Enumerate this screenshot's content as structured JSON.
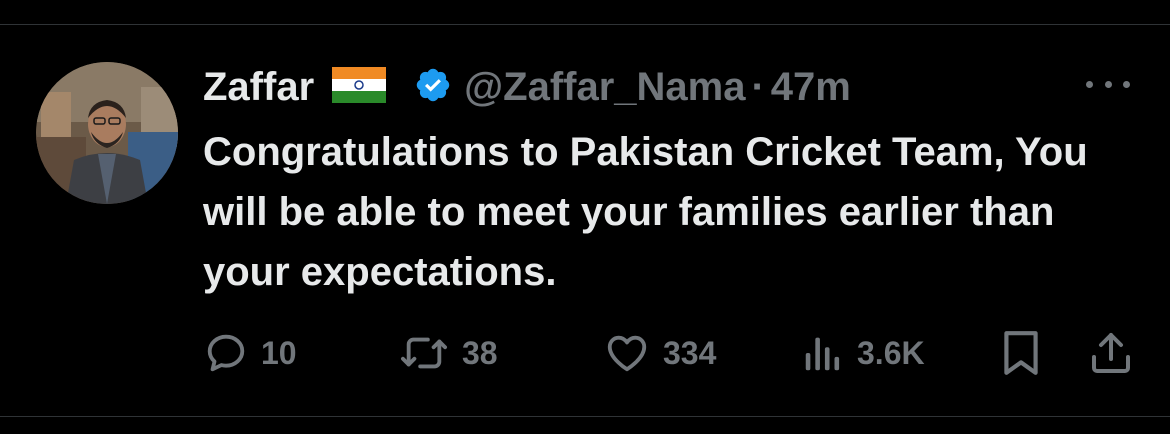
{
  "tweet": {
    "author": {
      "display_name": "Zaffar",
      "flag": "indian-flag",
      "verified_icon": "verified-badge-icon",
      "handle": "@Zaffar_Nama",
      "separator": "·",
      "time": "47m"
    },
    "text": "Congratulations to Pakistan Cricket Team, You will be able to meet your families earlier than your expectations.",
    "more_icon": "more-dots-icon"
  },
  "actions": {
    "replies": {
      "icon": "reply-icon",
      "count": "10"
    },
    "retweets": {
      "icon": "retweet-icon",
      "count": "38"
    },
    "likes": {
      "icon": "heart-icon",
      "count": "334"
    },
    "views": {
      "icon": "views-chart-icon",
      "count": "3.6K"
    },
    "bookmark": {
      "icon": "bookmark-icon"
    },
    "share": {
      "icon": "share-icon"
    }
  },
  "colors": {
    "background": "#000000",
    "primary_text": "#e7e9ea",
    "secondary_text": "#71767b",
    "verified_blue": "#1d9bf0",
    "divider": "#2f3336"
  }
}
